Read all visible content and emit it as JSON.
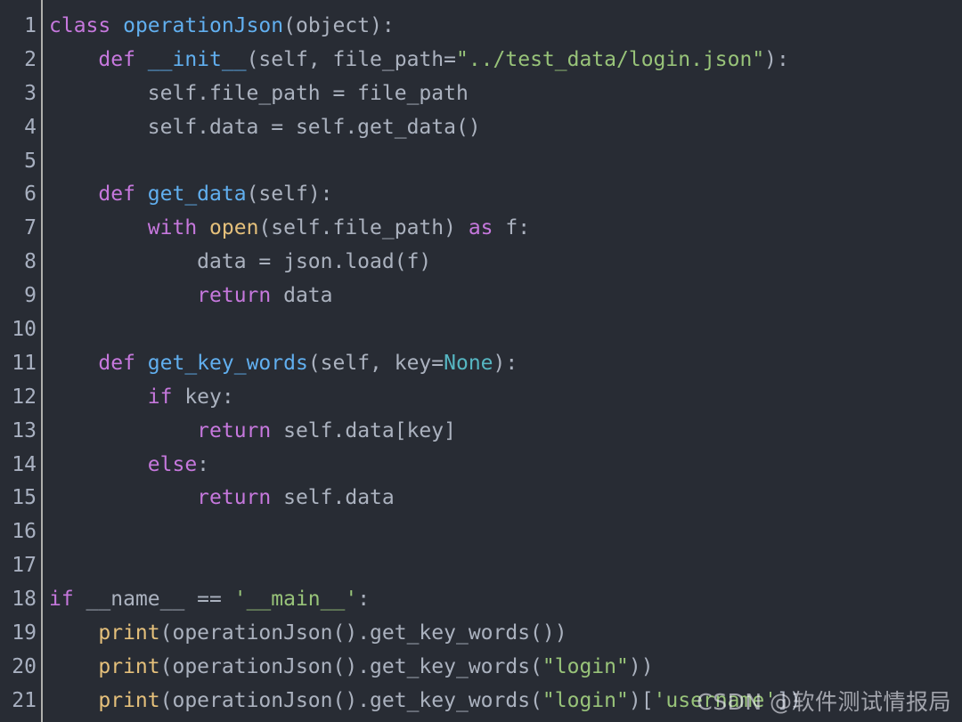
{
  "editor": {
    "language": "python",
    "theme": "one-dark",
    "background_color": "#282c34",
    "gutter_text_color": "#a8b0c0",
    "default_text_color": "#abb2bf",
    "colors": {
      "keyword": "#c678dd",
      "class_name": "#61afef",
      "function_name": "#61afef",
      "builtin": "#e5c07b",
      "string": "#98c379",
      "constant": "#56b6c2",
      "plain": "#abb2bf"
    }
  },
  "watermark": {
    "text": "CSDN @软件测试情报局"
  },
  "lines": [
    {
      "number": "1",
      "text": "class operationJson(object):"
    },
    {
      "number": "2",
      "text": "    def __init__(self, file_path=\"../test_data/login.json\"):"
    },
    {
      "number": "3",
      "text": "        self.file_path = file_path"
    },
    {
      "number": "4",
      "text": "        self.data = self.get_data()"
    },
    {
      "number": "5",
      "text": ""
    },
    {
      "number": "6",
      "text": "    def get_data(self):"
    },
    {
      "number": "7",
      "text": "        with open(self.file_path) as f:"
    },
    {
      "number": "8",
      "text": "            data = json.load(f)"
    },
    {
      "number": "9",
      "text": "            return data"
    },
    {
      "number": "10",
      "text": ""
    },
    {
      "number": "11",
      "text": "    def get_key_words(self, key=None):"
    },
    {
      "number": "12",
      "text": "        if key:"
    },
    {
      "number": "13",
      "text": "            return self.data[key]"
    },
    {
      "number": "14",
      "text": "        else:"
    },
    {
      "number": "15",
      "text": "            return self.data"
    },
    {
      "number": "16",
      "text": ""
    },
    {
      "number": "17",
      "text": ""
    },
    {
      "number": "18",
      "text": "if __name__ == '__main__':"
    },
    {
      "number": "19",
      "text": "    print(operationJson().get_key_words())"
    },
    {
      "number": "20",
      "text": "    print(operationJson().get_key_words(\"login\"))"
    },
    {
      "number": "21",
      "text": "    print(operationJson().get_key_words(\"login\")['username'])"
    }
  ],
  "tokens": [
    [
      {
        "t": "class",
        "c": "kw"
      },
      {
        "t": " ",
        "c": "pln"
      },
      {
        "t": "operationJson",
        "c": "cls"
      },
      {
        "t": "(",
        "c": "pln"
      },
      {
        "t": "object",
        "c": "pln"
      },
      {
        "t": "):",
        "c": "pln"
      }
    ],
    [
      {
        "t": "    ",
        "c": "pln"
      },
      {
        "t": "def",
        "c": "kw"
      },
      {
        "t": " ",
        "c": "pln"
      },
      {
        "t": "__init__",
        "c": "fn"
      },
      {
        "t": "(self, file_path=",
        "c": "pln"
      },
      {
        "t": "\"../test_data/login.json\"",
        "c": "str"
      },
      {
        "t": "):",
        "c": "pln"
      }
    ],
    [
      {
        "t": "        self.file_path = file_path",
        "c": "pln"
      }
    ],
    [
      {
        "t": "        self.data = self.get_data()",
        "c": "pln"
      }
    ],
    [
      {
        "t": "",
        "c": "pln"
      }
    ],
    [
      {
        "t": "    ",
        "c": "pln"
      },
      {
        "t": "def",
        "c": "kw"
      },
      {
        "t": " ",
        "c": "pln"
      },
      {
        "t": "get_data",
        "c": "fn"
      },
      {
        "t": "(self):",
        "c": "pln"
      }
    ],
    [
      {
        "t": "        ",
        "c": "pln"
      },
      {
        "t": "with",
        "c": "kw"
      },
      {
        "t": " ",
        "c": "pln"
      },
      {
        "t": "open",
        "c": "bi"
      },
      {
        "t": "(self.file_path) ",
        "c": "pln"
      },
      {
        "t": "as",
        "c": "kw"
      },
      {
        "t": " f:",
        "c": "pln"
      }
    ],
    [
      {
        "t": "            data = json.load(f)",
        "c": "pln"
      }
    ],
    [
      {
        "t": "            ",
        "c": "pln"
      },
      {
        "t": "return",
        "c": "kw"
      },
      {
        "t": " data",
        "c": "pln"
      }
    ],
    [
      {
        "t": "",
        "c": "pln"
      }
    ],
    [
      {
        "t": "    ",
        "c": "pln"
      },
      {
        "t": "def",
        "c": "kw"
      },
      {
        "t": " ",
        "c": "pln"
      },
      {
        "t": "get_key_words",
        "c": "fn"
      },
      {
        "t": "(self, key=",
        "c": "pln"
      },
      {
        "t": "None",
        "c": "cst"
      },
      {
        "t": "):",
        "c": "pln"
      }
    ],
    [
      {
        "t": "        ",
        "c": "pln"
      },
      {
        "t": "if",
        "c": "kw"
      },
      {
        "t": " key:",
        "c": "pln"
      }
    ],
    [
      {
        "t": "            ",
        "c": "pln"
      },
      {
        "t": "return",
        "c": "kw"
      },
      {
        "t": " self.data[key]",
        "c": "pln"
      }
    ],
    [
      {
        "t": "        ",
        "c": "pln"
      },
      {
        "t": "else",
        "c": "kw"
      },
      {
        "t": ":",
        "c": "pln"
      }
    ],
    [
      {
        "t": "            ",
        "c": "pln"
      },
      {
        "t": "return",
        "c": "kw"
      },
      {
        "t": " self.data",
        "c": "pln"
      }
    ],
    [
      {
        "t": "",
        "c": "pln"
      }
    ],
    [
      {
        "t": "",
        "c": "pln"
      }
    ],
    [
      {
        "t": "",
        "c": "pln"
      },
      {
        "t": "if",
        "c": "kw"
      },
      {
        "t": " __name__ == ",
        "c": "pln"
      },
      {
        "t": "'__main__'",
        "c": "str"
      },
      {
        "t": ":",
        "c": "pln"
      }
    ],
    [
      {
        "t": "    ",
        "c": "pln"
      },
      {
        "t": "print",
        "c": "bi"
      },
      {
        "t": "(operationJson().get_key_words())",
        "c": "pln"
      }
    ],
    [
      {
        "t": "    ",
        "c": "pln"
      },
      {
        "t": "print",
        "c": "bi"
      },
      {
        "t": "(operationJson().get_key_words(",
        "c": "pln"
      },
      {
        "t": "\"login\"",
        "c": "str"
      },
      {
        "t": "))",
        "c": "pln"
      }
    ],
    [
      {
        "t": "    ",
        "c": "pln"
      },
      {
        "t": "print",
        "c": "bi"
      },
      {
        "t": "(operationJson().get_key_words(",
        "c": "pln"
      },
      {
        "t": "\"login\"",
        "c": "str"
      },
      {
        "t": ")[",
        "c": "pln"
      },
      {
        "t": "'username'",
        "c": "str"
      },
      {
        "t": "])",
        "c": "pln"
      }
    ]
  ]
}
